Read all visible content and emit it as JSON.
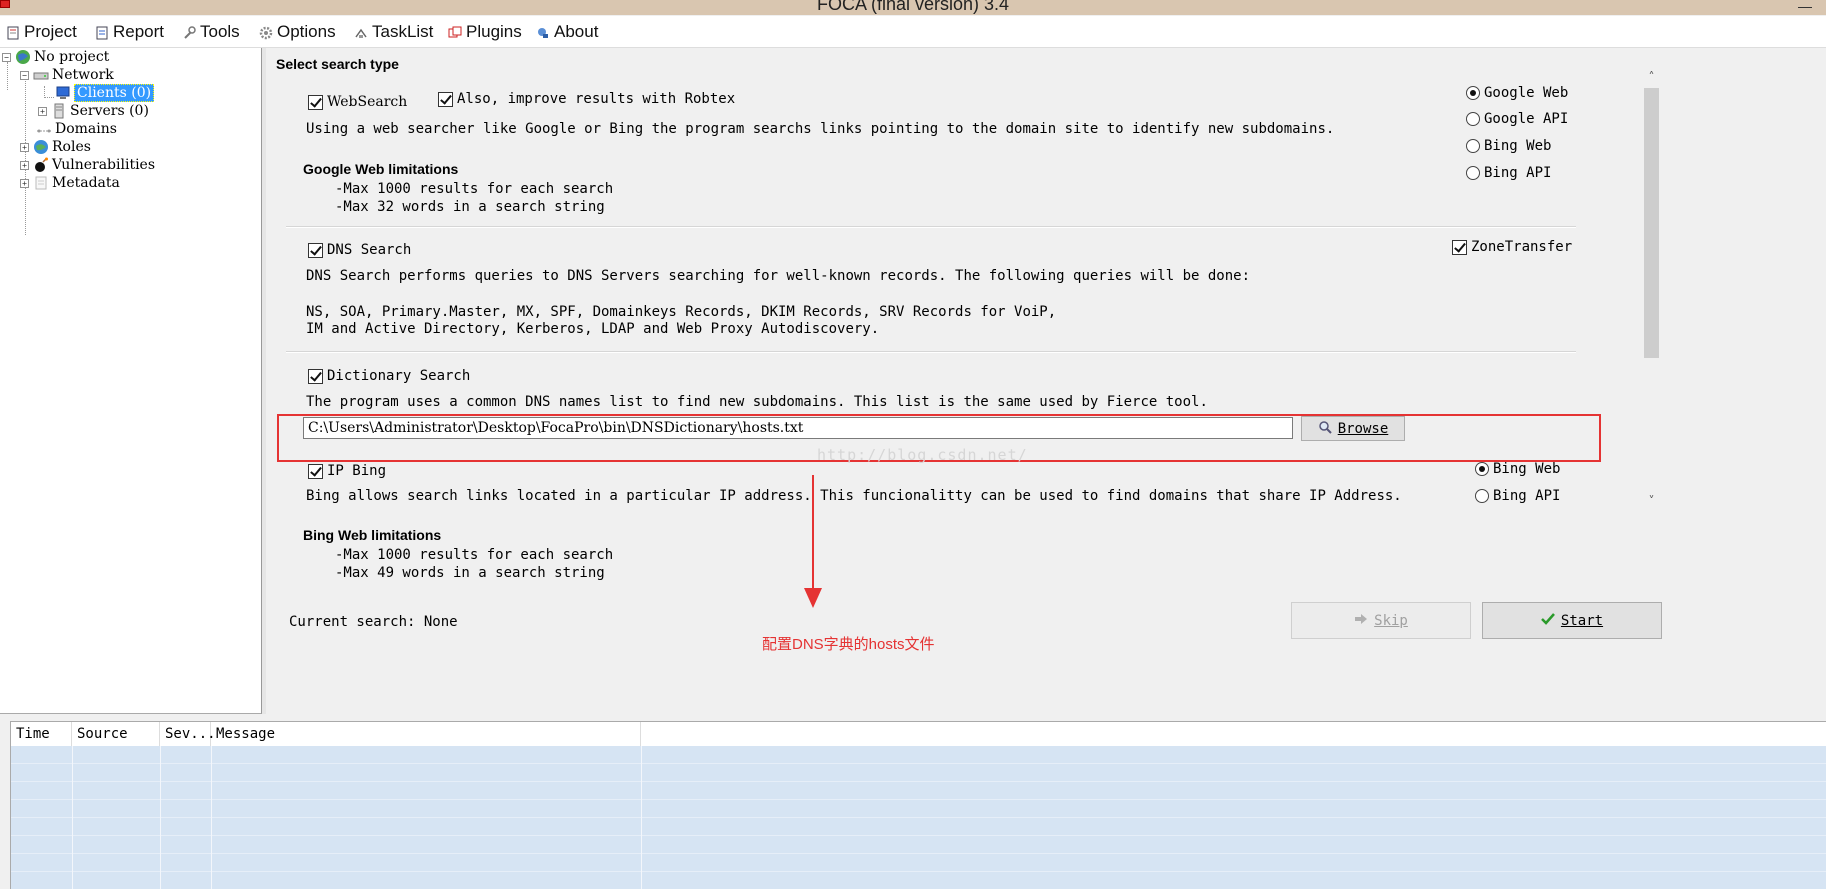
{
  "window": {
    "title": "FOCA (final version) 3.4"
  },
  "menu": {
    "items": [
      {
        "label": "Project",
        "icon": "document-icon"
      },
      {
        "label": "Report",
        "icon": "report-icon"
      },
      {
        "label": "Tools",
        "icon": "tools-icon"
      },
      {
        "label": "Options",
        "icon": "gear-icon"
      },
      {
        "label": "TaskList",
        "icon": "tasklist-icon"
      },
      {
        "label": "Plugins",
        "icon": "plugins-icon"
      },
      {
        "label": "About",
        "icon": "about-icon"
      }
    ]
  },
  "tree": {
    "root": "No project",
    "network": "Network",
    "clients": "Clients (0)",
    "servers": "Servers (0)",
    "domains": "Domains",
    "roles": "Roles",
    "vulnerabilities": "Vulnerabilities",
    "metadata": "Metadata"
  },
  "search": {
    "header": "Select search type",
    "websearch": {
      "label": "WebSearch",
      "robtex_label": "Also, improve results with Robtex",
      "description": "Using a web searcher like Google or Bing the program searchs links pointing to the domain site to identify new subdomains.",
      "limits_title": "Google Web limitations",
      "limit1": "-Max 1000 results for each search",
      "limit2": "-Max 32 words in a search string",
      "engines": [
        "Google Web",
        "Google API",
        "Bing Web",
        "Bing API"
      ],
      "selected_engine": "Google Web"
    },
    "dns": {
      "label": "DNS Search",
      "zone_transfer_label": "ZoneTransfer",
      "description": "DNS Search performs queries to DNS Servers searching for well-known records. The following queries will be done:",
      "records_line1": "NS, SOA, Primary.Master, MX, SPF, Domainkeys Records, DKIM Records, SRV Records for VoiP,",
      "records_line2": "IM and Active Directory, Kerberos, LDAP and Web Proxy Autodiscovery."
    },
    "dictionary": {
      "label": "Dictionary Search",
      "description": "The program uses a common DNS names list to find new subdomains. This list is the same used by Fierce tool.",
      "path": "C:\\Users\\Administrator\\Desktop\\FocaPro\\bin\\DNSDictionary\\hosts.txt",
      "browse_label": "Browse"
    },
    "ipbing": {
      "label": "IP Bing",
      "description": "Bing allows search links located in a particular IP address. This funcionalitty can be used to find domains that share IP Address.",
      "limits_title": "Bing Web limitations",
      "limit1": "-Max 1000 results for each search",
      "limit2": "-Max 49 words in a search string",
      "engines": [
        "Bing Web",
        "Bing API"
      ],
      "selected_engine": "Bing Web"
    },
    "current_search": "Current search: None",
    "skip_label": "Skip",
    "start_label": "Start"
  },
  "annotation": {
    "text": "配置DNS字典的hosts文件",
    "watermark": "http://blog.csdn.net/",
    "color": "#e53333"
  },
  "log": {
    "columns": [
      "Time",
      "Source",
      "Sev...",
      "Message"
    ]
  }
}
